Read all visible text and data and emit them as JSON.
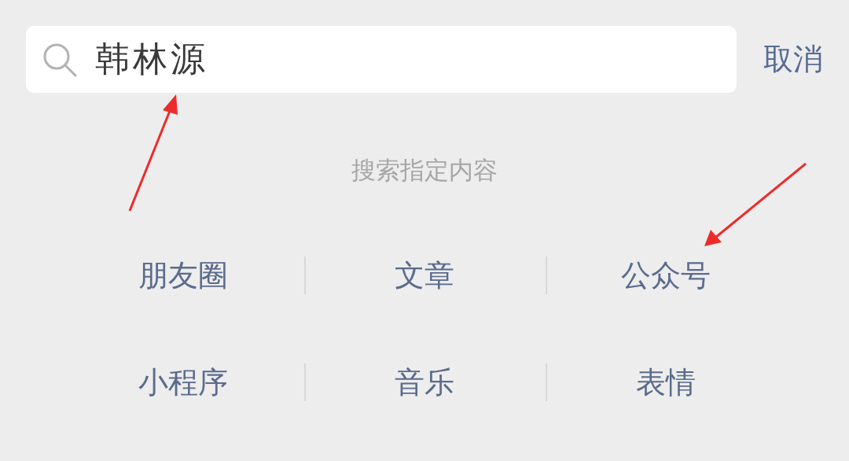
{
  "search": {
    "value": "韩林源"
  },
  "cancel_button": "取消",
  "hint": "搜索指定内容",
  "categories": [
    {
      "label": "朋友圈"
    },
    {
      "label": "文章"
    },
    {
      "label": "公众号"
    },
    {
      "label": "小程序"
    },
    {
      "label": "音乐"
    },
    {
      "label": "表情"
    }
  ]
}
